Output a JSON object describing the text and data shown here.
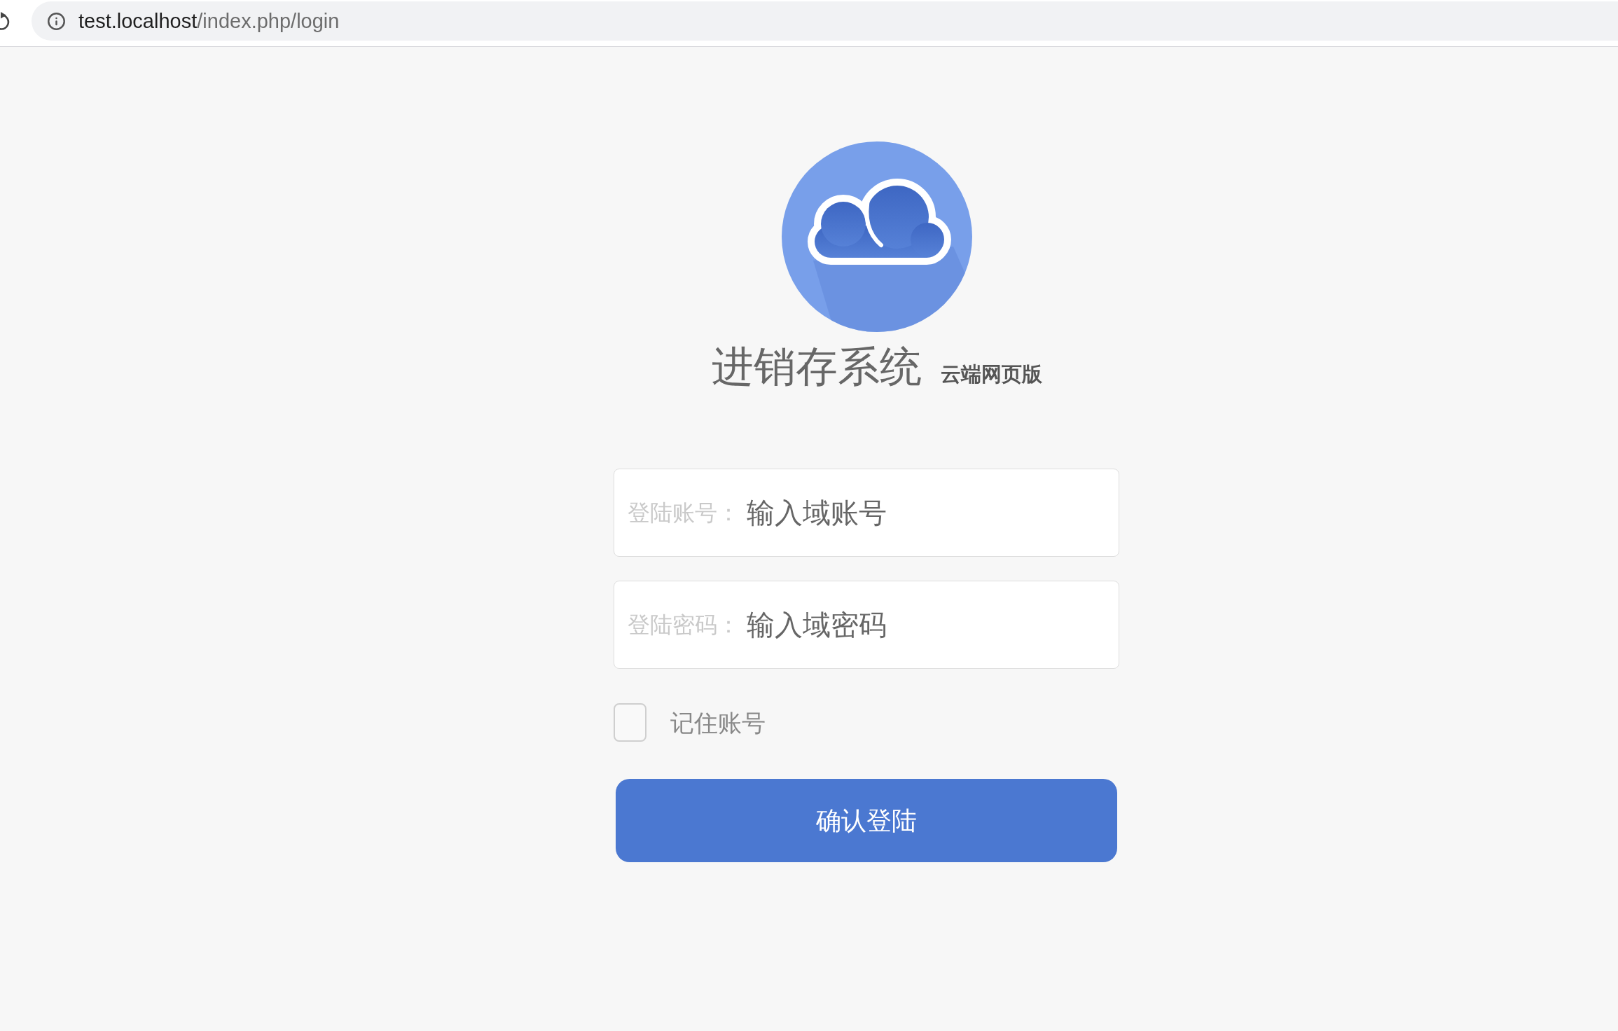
{
  "browser": {
    "url_host": "test.localhost",
    "url_path": "/index.php/login"
  },
  "app": {
    "title": "进销存系统",
    "subtitle": "云端网页版"
  },
  "form": {
    "fields": [
      {
        "label": "登陆账号：",
        "placeholder": "输入域账号"
      },
      {
        "label": "登陆密码：",
        "placeholder": "输入域密码"
      }
    ],
    "remember": {
      "label": "记住账号",
      "checked": false
    },
    "submit": "确认登陆"
  }
}
